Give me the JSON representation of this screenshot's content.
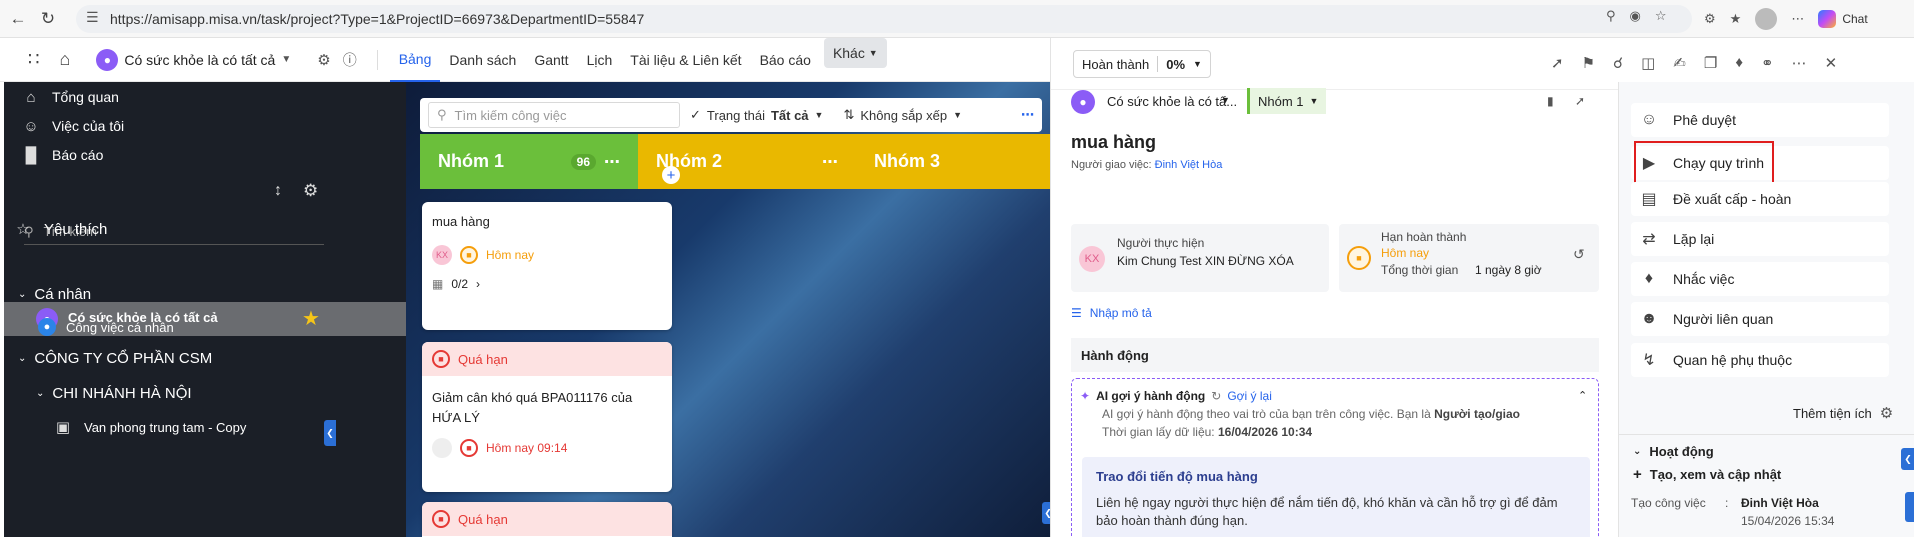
{
  "browser": {
    "url": "https://amisapp.misa.vn/task/project?Type=1&ProjectID=66973&DepartmentID=55847",
    "chat_label": "Chat"
  },
  "appbar": {
    "project_name": "Có sức khỏe là có tất cả",
    "tabs": [
      "Bảng",
      "Danh sách",
      "Gantt",
      "Lịch",
      "Tài liệu & Liên kết",
      "Báo cáo"
    ],
    "active_tab": "Bảng",
    "more_label": "Khác"
  },
  "sidebar": {
    "nav": [
      "Tổng quan",
      "Việc của tôi",
      "Báo cáo"
    ],
    "search_placeholder": "Tìm kiếm",
    "favorites_label": "Yêu thích",
    "favorite_project": "Có sức khỏe là có tất cả",
    "personal_label": "Cá nhân",
    "personal_item": "Công việc cá nhân",
    "company_label": "CÔNG TY CỔ PHẦN CSM",
    "branch_label": "CHI NHÁNH HÀ NỘI",
    "office_label": "Van phong trung tam - Copy"
  },
  "board": {
    "search_placeholder": "Tìm kiếm công việc",
    "status_filter_label": "Trạng thái",
    "status_filter_value": "Tất cả",
    "sort_label": "Không sắp xếp",
    "columns": [
      {
        "name": "Nhóm 1",
        "count": "96",
        "color": "#6bbf3b"
      },
      {
        "name": "Nhóm 2",
        "count": "",
        "color": "#e9b800"
      },
      {
        "name": "Nhóm 3",
        "count": "",
        "color": "#e9b800"
      }
    ],
    "cards": [
      {
        "title": "mua hàng",
        "avatar": "KX",
        "date": "Hôm nay",
        "subtasks": "0/2"
      },
      {
        "badge": "Quá hạn",
        "title": "Giảm cân khó quá BPA011176 của HỨA LÝ",
        "date": "Hôm nay 09:14"
      },
      {
        "badge": "Quá hạn"
      }
    ]
  },
  "detail": {
    "status_label": "Hoàn thành",
    "status_percent": "0%",
    "project_name": "Có sức khỏe là có tấ...",
    "group_name": "Nhóm 1",
    "task_title": "mua hàng",
    "assigner_label": "Người giao việc:",
    "assigner_name": "Đinh Việt Hòa",
    "executor_label": "Người thực hiện",
    "executor_avatar": "KX",
    "executor_name": "Kim Chung Test XIN ĐỪNG XÓA",
    "deadline_label": "Hạn hoàn thành",
    "deadline_value": "Hôm nay",
    "total_time_label": "Tổng thời gian",
    "total_time_value": "1 ngày 8 giờ",
    "description_link": "Nhập mô tả",
    "actions_header": "Hành động",
    "ai_title": "AI gợi ý hành động",
    "ai_retry": "Gợi ý lại",
    "ai_desc_prefix": "AI gợi ý hành động theo vai trò của bạn trên công việc. Bạn là",
    "ai_role": "Người tạo/giao",
    "ai_time_label": "Thời gian lấy dữ liệu:",
    "ai_time_value": "16/04/2026 10:34",
    "suggestion_title": "Trao đổi tiến độ mua hàng",
    "suggestion_body": "Liên hệ ngay người thực hiện để nắm tiến độ, khó khăn và cần hỗ trợ gì để đảm bảo hoàn thành đúng hạn."
  },
  "actions_panel": {
    "items": [
      "Phê duyệt",
      "Chạy quy trình",
      "Đề xuất cấp - hoàn",
      "Lặp lại",
      "Nhắc việc",
      "Người liên quan",
      "Quan hệ phụ thuộc"
    ],
    "more_utilities": "Thêm tiện ích",
    "activity_label": "Hoạt động",
    "create_view_update": "Tạo, xem và cập nhật",
    "create_task_label": "Tạo công việc",
    "create_task_user": "Đinh Việt Hòa",
    "create_task_time": "15/04/2026 15:34"
  }
}
